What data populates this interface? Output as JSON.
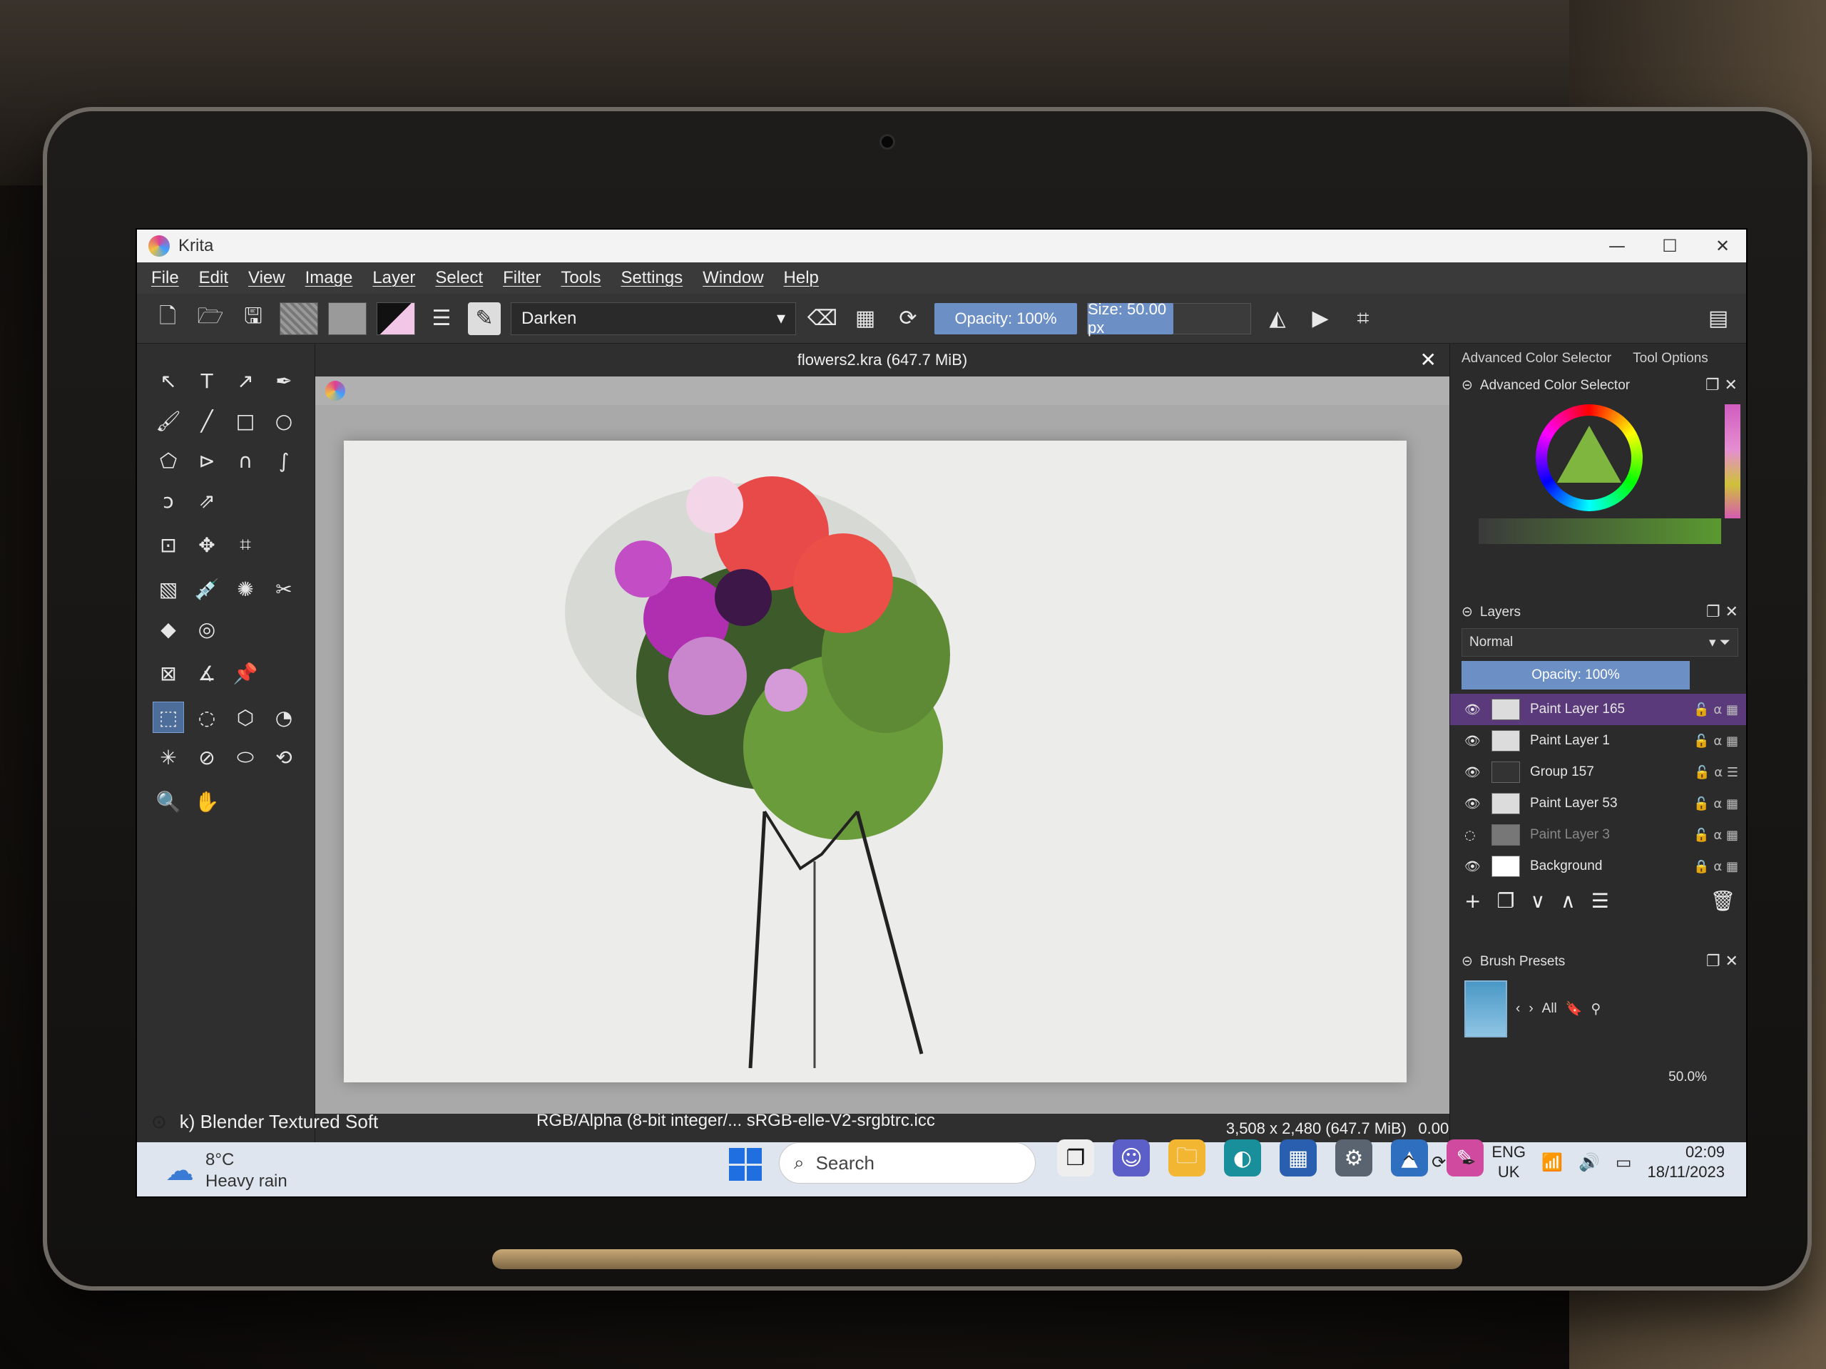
{
  "window": {
    "title": "Krita",
    "controls": [
      "minimize",
      "maximize",
      "close"
    ]
  },
  "menu": [
    "File",
    "Edit",
    "View",
    "Image",
    "Layer",
    "Select",
    "Filter",
    "Tools",
    "Settings",
    "Window",
    "Help"
  ],
  "toolbar": {
    "blend_mode": "Darken",
    "opacity": "Opacity: 100%",
    "size": "Size: 50.00 px"
  },
  "document": {
    "tab_title": "flowers2.kra (647.7 MiB)",
    "info": "3,508 x 2,480 (647.7 MiB)",
    "rotation": "0.00°"
  },
  "dockers": {
    "tabs": [
      "Advanced Color Selector",
      "Tool Options"
    ],
    "color_selector_title": "Advanced Color Selector",
    "layers": {
      "title": "Layers",
      "blend_mode": "Normal",
      "opacity": "Opacity: 100%",
      "items": [
        {
          "name": "Paint Layer 165",
          "selected": true,
          "visible": true
        },
        {
          "name": "Paint Layer 1",
          "selected": false,
          "visible": true
        },
        {
          "name": "Group 157",
          "selected": false,
          "visible": true
        },
        {
          "name": "Paint Layer 53",
          "selected": false,
          "visible": true
        },
        {
          "name": "Paint Layer 3",
          "selected": false,
          "visible": false
        },
        {
          "name": "Background",
          "selected": false,
          "visible": true
        }
      ]
    },
    "brush_presets": {
      "title": "Brush Presets",
      "filter": "All",
      "zoom": "50.0%"
    }
  },
  "status": {
    "brush_name": "k) Blender Textured Soft",
    "color_space": "RGB/Alpha (8-bit integer/... sRGB-elle-V2-srgbtrc.icc"
  },
  "taskbar": {
    "weather_temp": "8°C",
    "weather_desc": "Heavy rain",
    "search_placeholder": "Search",
    "language": "ENG",
    "region": "UK",
    "time": "02:09",
    "date": "18/11/2023"
  },
  "colors": {
    "accent": "#6c8fc5",
    "selected_layer": "#5a3a7a",
    "taskbar": "#dfe5ee"
  }
}
